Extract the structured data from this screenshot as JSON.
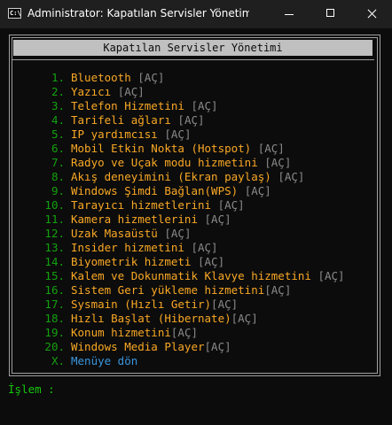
{
  "window": {
    "title": "Administrator:  Kapatılan Servisler Yönetimi / Ogn…",
    "icon": "cmd-icon",
    "icon_text": "C:\\"
  },
  "menu": {
    "header": "Kapatılan Servisler Yönetimi",
    "items": [
      {
        "num": "1.",
        "label": "Bluetooth",
        "status": "[AÇ]"
      },
      {
        "num": "2.",
        "label": "Yazıcı",
        "status": "[AÇ]"
      },
      {
        "num": "3.",
        "label": "Telefon Hizmetini",
        "status": "[AÇ]"
      },
      {
        "num": "4.",
        "label": "Tarifeli ağları",
        "status": "[AÇ]"
      },
      {
        "num": "5.",
        "label": "IP yardımcısı",
        "status": "[AÇ]"
      },
      {
        "num": "6.",
        "label": "Mobil Etkin Nokta (Hotspot)",
        "status": "[AÇ]"
      },
      {
        "num": "7.",
        "label": "Radyo ve Uçak modu hizmetini",
        "status": "[AÇ]"
      },
      {
        "num": "8.",
        "label": "Akış deneyimini (Ekran paylaş)",
        "status": "[AÇ]"
      },
      {
        "num": "9.",
        "label": "Windows Şimdi Bağlan(WPS)",
        "status": "[AÇ]"
      },
      {
        "num": "10.",
        "label": "Tarayıcı hizmetlerini",
        "status": "[AÇ]"
      },
      {
        "num": "11.",
        "label": "Kamera hizmetlerini",
        "status": "[AÇ]"
      },
      {
        "num": "12.",
        "label": "Uzak Masaüstü",
        "status": "[AÇ]"
      },
      {
        "num": "13.",
        "label": "Insider hizmetini",
        "status": "[AÇ]"
      },
      {
        "num": "14.",
        "label": "Biyometrik hizmeti",
        "status": "[AÇ]"
      },
      {
        "num": "15.",
        "label": "Kalem ve Dokunmatik Klavye hizmetini",
        "status": "[AÇ]"
      },
      {
        "num": "16.",
        "label": "Sistem Geri yükleme hizmetini",
        "status": "[AÇ]"
      },
      {
        "num": "17.",
        "label": "Sysmain (Hızlı Getir)",
        "status": "[AÇ]"
      },
      {
        "num": "18.",
        "label": "Hızlı Başlat (Hibernate)",
        "status": "[AÇ]"
      },
      {
        "num": "19.",
        "label": "Konum hizmetini",
        "status": "[AÇ]"
      },
      {
        "num": "20.",
        "label": "Windows Media Player",
        "status": "[AÇ]"
      }
    ],
    "back": {
      "num": "X.",
      "label": "Menüye dön"
    }
  },
  "prompt": {
    "text": "İşlem : "
  },
  "colors": {
    "background": "#0c0c0c",
    "number": "#13a10e",
    "label": "#f9a825",
    "status": "#8a8a8a",
    "back_label": "#3a96dd",
    "prompt": "#16c60c"
  }
}
